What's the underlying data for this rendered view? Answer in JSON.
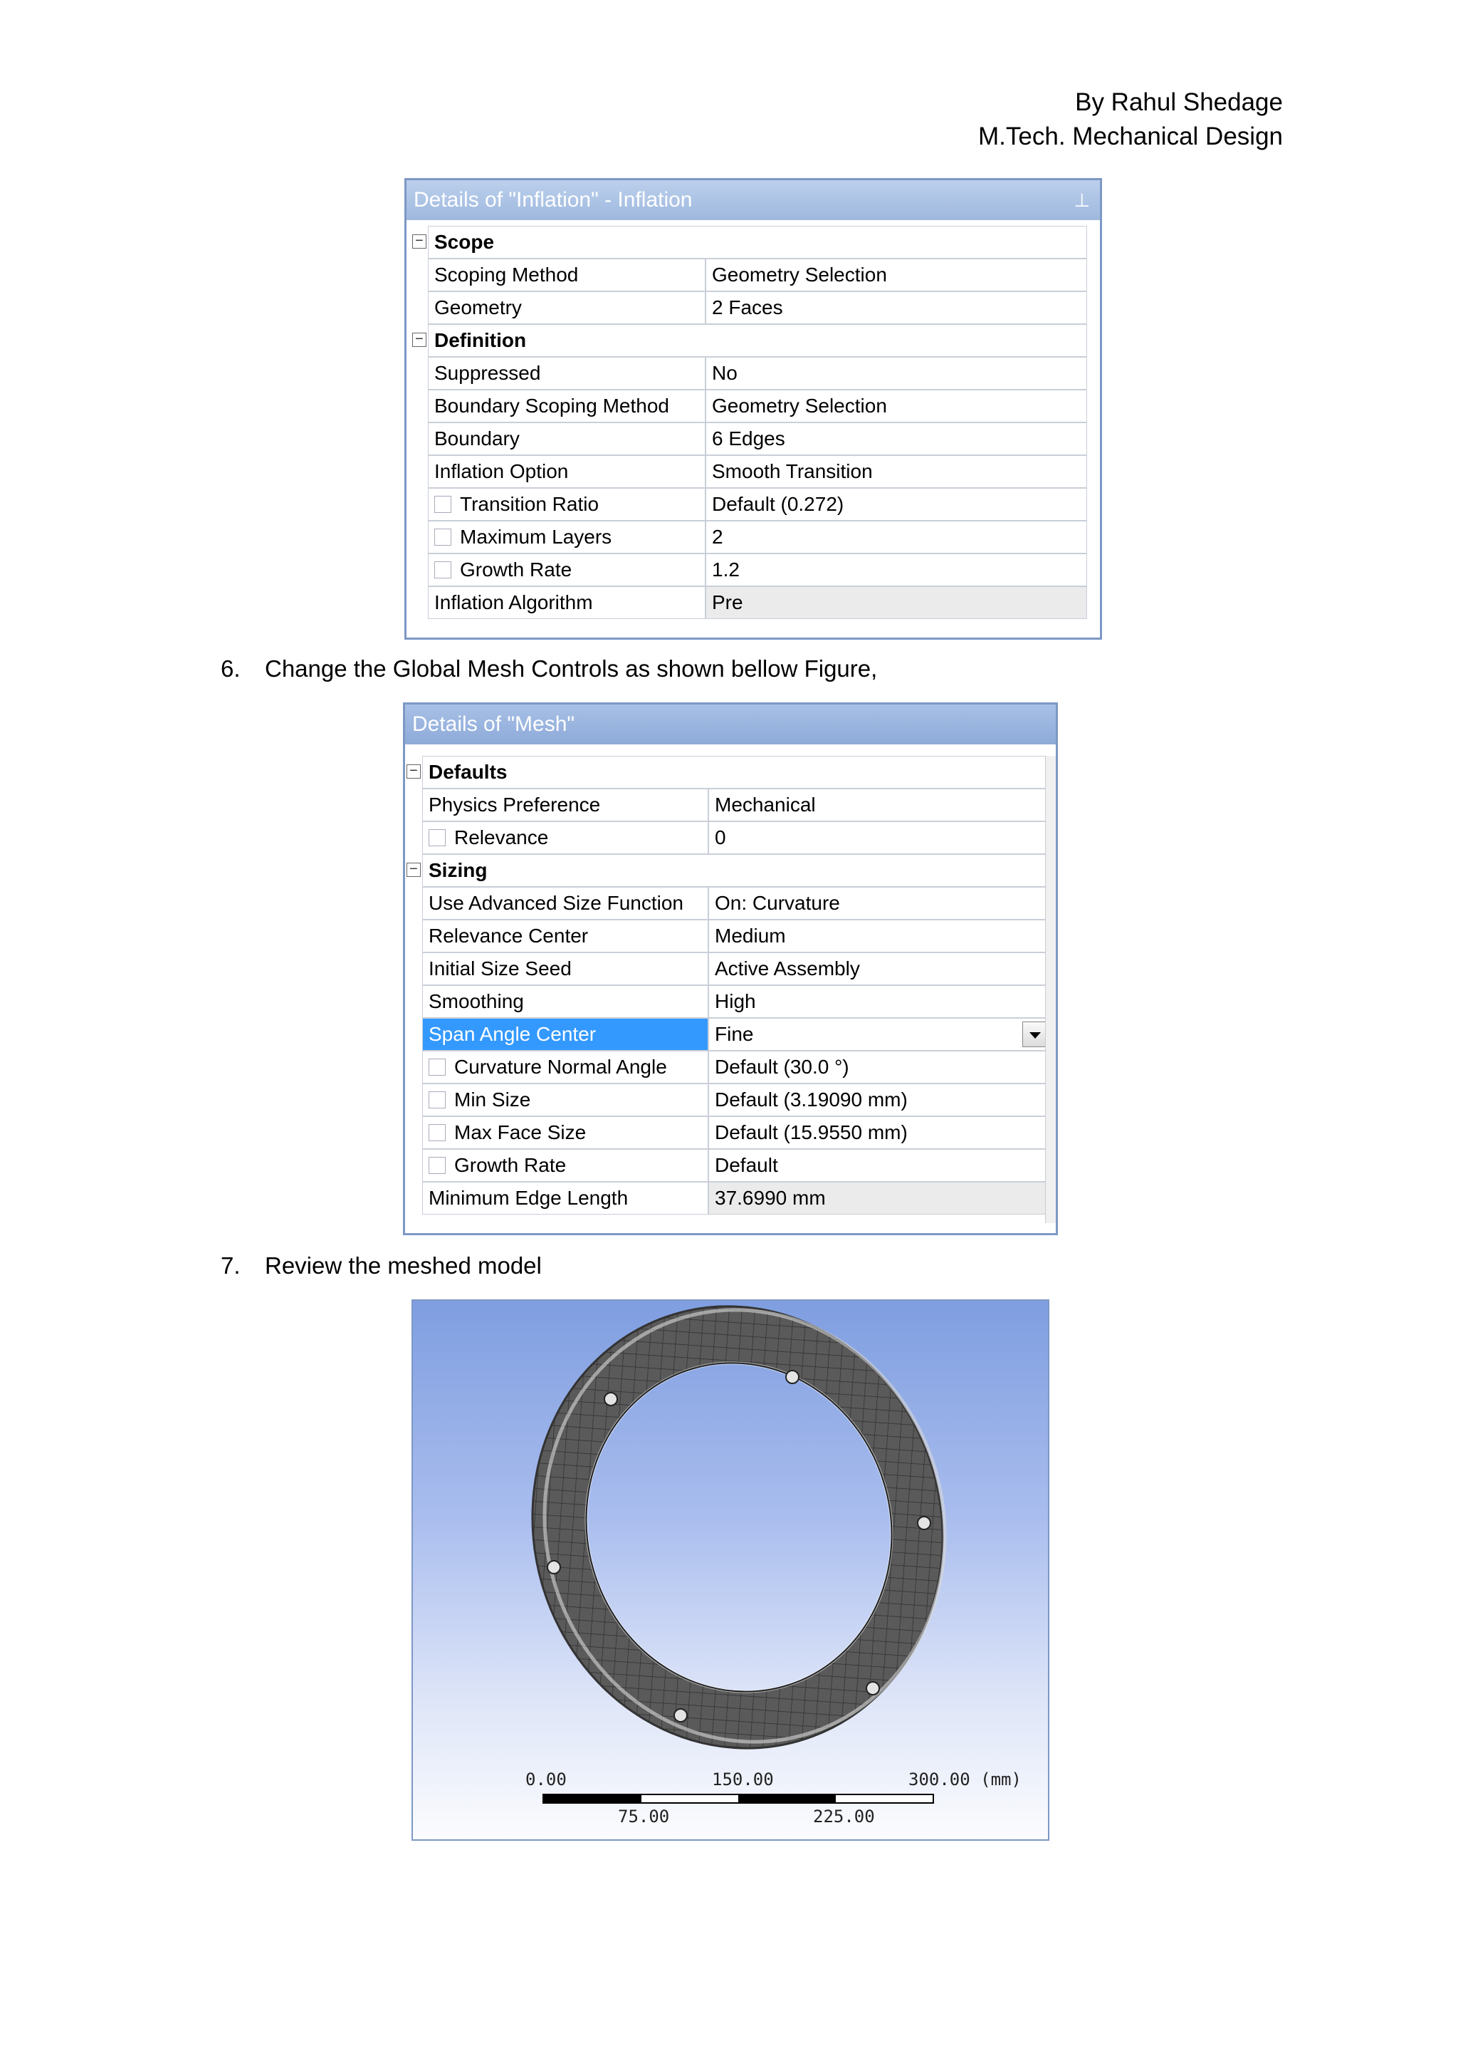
{
  "header": {
    "author": "By Rahul Shedage",
    "degree": "M.Tech. Mechanical Design"
  },
  "inflation_panel": {
    "title": "Details of \"Inflation\" - Inflation",
    "pin": "📌",
    "rows": [
      {
        "type": "cat",
        "label": "Scope"
      },
      {
        "type": "prop",
        "label": "Scoping Method",
        "value": "Geometry Selection"
      },
      {
        "type": "prop",
        "label": "Geometry",
        "value": "2 Faces"
      },
      {
        "type": "cat",
        "label": "Definition"
      },
      {
        "type": "prop",
        "label": "Suppressed",
        "value": "No"
      },
      {
        "type": "prop",
        "label": "Boundary Scoping Method",
        "value": "Geometry Selection"
      },
      {
        "type": "prop",
        "label": "Boundary",
        "value": "6 Edges"
      },
      {
        "type": "prop",
        "label": "Inflation Option",
        "value": "Smooth Transition"
      },
      {
        "type": "check",
        "label": "Transition Ratio",
        "value": "Default (0.272)"
      },
      {
        "type": "check",
        "label": "Maximum Layers",
        "value": "2"
      },
      {
        "type": "check",
        "label": "Growth Rate",
        "value": "1.2"
      },
      {
        "type": "prop",
        "label": "Inflation Algorithm",
        "value": "Pre",
        "shaded": true
      }
    ]
  },
  "step6": {
    "num": "6.",
    "text": "Change the Global Mesh Controls as shown bellow Figure,"
  },
  "mesh_panel": {
    "title": "Details of \"Mesh\"",
    "rows": [
      {
        "type": "cat",
        "label": "Defaults"
      },
      {
        "type": "prop",
        "label": "Physics Preference",
        "value": "Mechanical"
      },
      {
        "type": "check",
        "label": "Relevance",
        "value": "0"
      },
      {
        "type": "cat",
        "label": "Sizing"
      },
      {
        "type": "prop",
        "label": "Use Advanced Size Function",
        "value": "On: Curvature"
      },
      {
        "type": "prop",
        "label": "Relevance Center",
        "value": "Medium"
      },
      {
        "type": "prop",
        "label": "Initial Size Seed",
        "value": "Active Assembly"
      },
      {
        "type": "prop",
        "label": "Smoothing",
        "value": "High"
      },
      {
        "type": "prop",
        "label": "Span Angle Center",
        "value": "Fine",
        "selected": true
      },
      {
        "type": "check",
        "label": "Curvature Normal Angle",
        "value": "Default (30.0 °)"
      },
      {
        "type": "check",
        "label": "Min Size",
        "value": "Default (3.19090 mm)"
      },
      {
        "type": "check",
        "label": "Max Face Size",
        "value": "Default (15.9550 mm)"
      },
      {
        "type": "check",
        "label": "Growth Rate",
        "value": "Default"
      },
      {
        "type": "prop",
        "label": "Minimum Edge Length",
        "value": "37.6990 mm",
        "shaded": true
      }
    ]
  },
  "step7": {
    "num": "7.",
    "text": "Review the meshed model"
  },
  "scale_bar": {
    "top_labels": [
      "0.00",
      "150.00",
      "300.00 (mm)"
    ],
    "bottom_labels": [
      "75.00",
      "225.00"
    ]
  },
  "colors": {
    "title_bar": "#a9c0e4",
    "selection": "#3399ff",
    "mesh_fill": "#555555"
  }
}
